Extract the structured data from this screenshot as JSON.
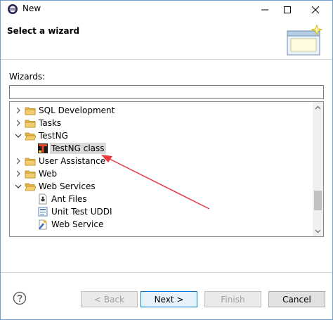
{
  "window": {
    "title": "New"
  },
  "banner": {
    "title": "Select a wizard"
  },
  "wizards_label": "Wizards:",
  "filter": {
    "value": "",
    "placeholder": ""
  },
  "tree": {
    "rows": [
      {
        "label": "SQL Development",
        "expanded": false,
        "level": 0,
        "type": "folder"
      },
      {
        "label": "Tasks",
        "expanded": false,
        "level": 0,
        "type": "folder"
      },
      {
        "label": "TestNG",
        "expanded": true,
        "level": 0,
        "type": "folder"
      },
      {
        "label": "TestNG class",
        "level": 1,
        "type": "testng-icon",
        "selected": true
      },
      {
        "label": "User Assistance",
        "expanded": false,
        "level": 0,
        "type": "folder"
      },
      {
        "label": "Web",
        "expanded": false,
        "level": 0,
        "type": "folder"
      },
      {
        "label": "Web Services",
        "expanded": true,
        "level": 0,
        "type": "folder"
      },
      {
        "label": "Ant Files",
        "level": 1,
        "type": "ant-file-icon"
      },
      {
        "label": "Unit Test UDDI",
        "level": 1,
        "type": "uddi-icon"
      },
      {
        "label": "Web Service",
        "level": 1,
        "type": "web-service-icon"
      }
    ]
  },
  "buttons": {
    "back": "< Back",
    "next": "Next >",
    "finish": "Finish",
    "cancel": "Cancel"
  },
  "colors": {
    "folder": "#e8b64a",
    "arrow": "#e8383d",
    "accent": "#0078d7"
  }
}
